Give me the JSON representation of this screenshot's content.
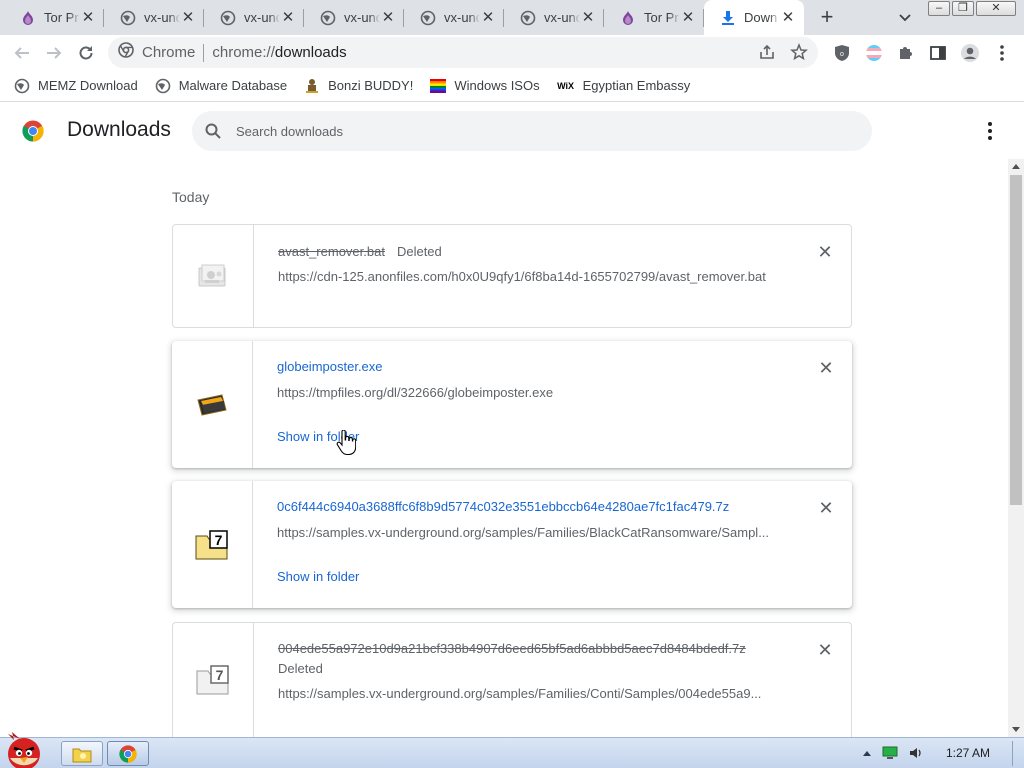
{
  "tabs": [
    {
      "title": "Tor Pr",
      "icon": "tor-onion-icon"
    },
    {
      "title": "vx-und",
      "icon": "globe-icon"
    },
    {
      "title": "vx-und",
      "icon": "globe-icon"
    },
    {
      "title": "vx-und",
      "icon": "globe-icon"
    },
    {
      "title": "vx-und",
      "icon": "globe-icon"
    },
    {
      "title": "vx-und",
      "icon": "globe-icon"
    },
    {
      "title": "Tor Pr",
      "icon": "tor-onion-icon"
    },
    {
      "title": "Down",
      "icon": "download-icon",
      "active": true
    }
  ],
  "tab_close_glyph": "✕",
  "new_tab_glyph": "+",
  "window_buttons": {
    "minimize": "–",
    "restore": "❐",
    "close": "✕"
  },
  "omnibox": {
    "chip": "Chrome",
    "url_scheme": "chrome://",
    "url_host": "downloads"
  },
  "bookmarks": [
    {
      "label": "MEMZ Download",
      "icon": "globe-icon"
    },
    {
      "label": "Malware Database",
      "icon": "globe-icon"
    },
    {
      "label": "Bonzi BUDDY!",
      "icon": "bonzi-icon"
    },
    {
      "label": "Windows ISOs",
      "icon": "rainbow-flag-icon"
    },
    {
      "label": "Egyptian Embassy",
      "icon": "wix-icon"
    }
  ],
  "bookmark_wix_text": "WiX",
  "downloads": {
    "title": "Downloads",
    "search_placeholder": "Search downloads",
    "section_label": "Today",
    "items": [
      {
        "file_name": "avast_remover.bat",
        "status": "Deleted",
        "url": "https://cdn-125.anonfiles.com/h0x0U9qfy1/6f8ba14d-1655702799/avast_remover.bat",
        "deleted": true,
        "icon": "batch-file-icon"
      },
      {
        "file_name": "globeimposter.exe",
        "status": "",
        "url": "https://tmpfiles.org/dl/322666/globeimposter.exe",
        "action": "Show in folder",
        "deleted": false,
        "icon": "exe-file-icon"
      },
      {
        "file_name": "0c6f444c6940a3688ffc6f8b9d5774c032e3551ebbccb64e4280ae7fc1fac479.7z",
        "status": "",
        "url": "https://samples.vx-underground.org/samples/Families/BlackCatRansomware/Sampl...",
        "action": "Show in folder",
        "deleted": false,
        "icon": "7z-archive-icon"
      },
      {
        "file_name": "004ede55a972e10d9a21bcf338b4907d6eed65bf5ad6abbbd5aec7d8484bdedf.7z",
        "status": "Deleted",
        "url": "https://samples.vx-underground.org/samples/Families/Conti/Samples/004ede55a9...",
        "deleted": true,
        "icon": "7z-archive-icon"
      }
    ]
  },
  "remove_glyph": "✕",
  "taskbar": {
    "clock": "1:27 AM",
    "apps": [
      {
        "name": "explorer",
        "icon": "folder-icon"
      },
      {
        "name": "chrome",
        "icon": "chrome-icon",
        "active": true
      }
    ]
  },
  "colors": {
    "accent": "#1967d2",
    "tabstrip": "#dee1e6",
    "omnibox": "#f1f3f4",
    "muted_text": "#5f6368"
  }
}
